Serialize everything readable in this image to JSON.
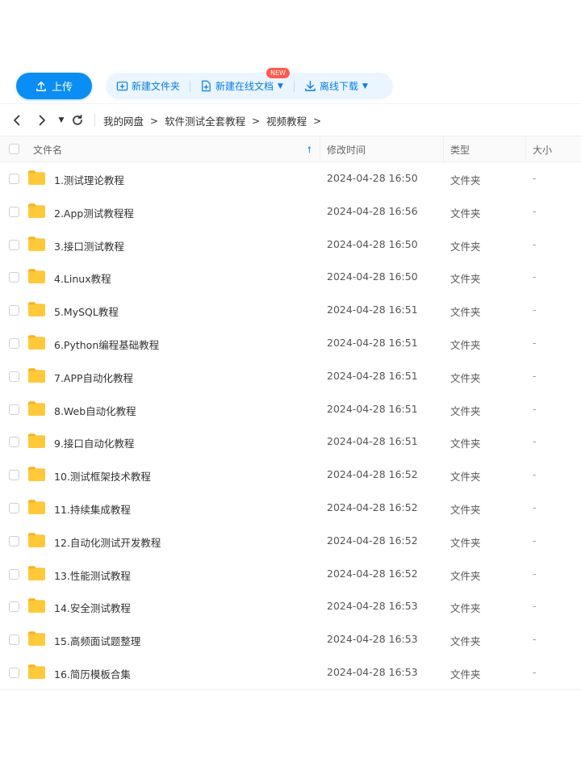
{
  "toolbar": {
    "upload_label": "上传",
    "new_folder_label": "新建文件夹",
    "new_online_doc_label": "新建在线文档",
    "new_badge": "NEW",
    "offline_download_label": "离线下载"
  },
  "breadcrumb": [
    "我的网盘",
    "软件测试全套教程",
    "视频教程"
  ],
  "table": {
    "headers": {
      "name": "文件名",
      "modified": "修改时间",
      "type": "类型",
      "size": "大小"
    },
    "rows": [
      {
        "name": "1.测试理论教程",
        "date": "2024-04-28 16:50",
        "type": "文件夹",
        "size": "-"
      },
      {
        "name": "2.App测试教程程",
        "date": "2024-04-28 16:56",
        "type": "文件夹",
        "size": "-"
      },
      {
        "name": "3.接口测试教程",
        "date": "2024-04-28 16:50",
        "type": "文件夹",
        "size": "-"
      },
      {
        "name": "4.Linux教程",
        "date": "2024-04-28 16:50",
        "type": "文件夹",
        "size": "-"
      },
      {
        "name": "5.MySQL教程",
        "date": "2024-04-28 16:51",
        "type": "文件夹",
        "size": "-"
      },
      {
        "name": "6.Python编程基础教程",
        "date": "2024-04-28 16:51",
        "type": "文件夹",
        "size": "-"
      },
      {
        "name": "7.APP自动化教程",
        "date": "2024-04-28 16:51",
        "type": "文件夹",
        "size": "-"
      },
      {
        "name": "8.Web自动化教程",
        "date": "2024-04-28 16:51",
        "type": "文件夹",
        "size": "-"
      },
      {
        "name": "9.接口自动化教程",
        "date": "2024-04-28 16:51",
        "type": "文件夹",
        "size": "-"
      },
      {
        "name": "10.测试框架技术教程",
        "date": "2024-04-28 16:52",
        "type": "文件夹",
        "size": "-"
      },
      {
        "name": "11.持续集成教程",
        "date": "2024-04-28 16:52",
        "type": "文件夹",
        "size": "-"
      },
      {
        "name": "12.自动化测试开发教程",
        "date": "2024-04-28 16:52",
        "type": "文件夹",
        "size": "-"
      },
      {
        "name": "13.性能测试教程",
        "date": "2024-04-28 16:52",
        "type": "文件夹",
        "size": "-"
      },
      {
        "name": "14.安全测试教程",
        "date": "2024-04-28 16:53",
        "type": "文件夹",
        "size": "-"
      },
      {
        "name": "15.高频面试题整理",
        "date": "2024-04-28 16:53",
        "type": "文件夹",
        "size": "-"
      },
      {
        "name": "16.简历模板合集",
        "date": "2024-04-28 16:53",
        "type": "文件夹",
        "size": "-"
      }
    ]
  },
  "colors": {
    "accent": "#0a8ef5",
    "folder": "#ffc42e",
    "badge": "#ff5a4e"
  },
  "icons": [
    "upload-icon",
    "new-folder-icon",
    "new-doc-icon",
    "download-icon",
    "back-icon",
    "forward-icon",
    "refresh-icon",
    "folder-icon",
    "sort-up-icon"
  ]
}
